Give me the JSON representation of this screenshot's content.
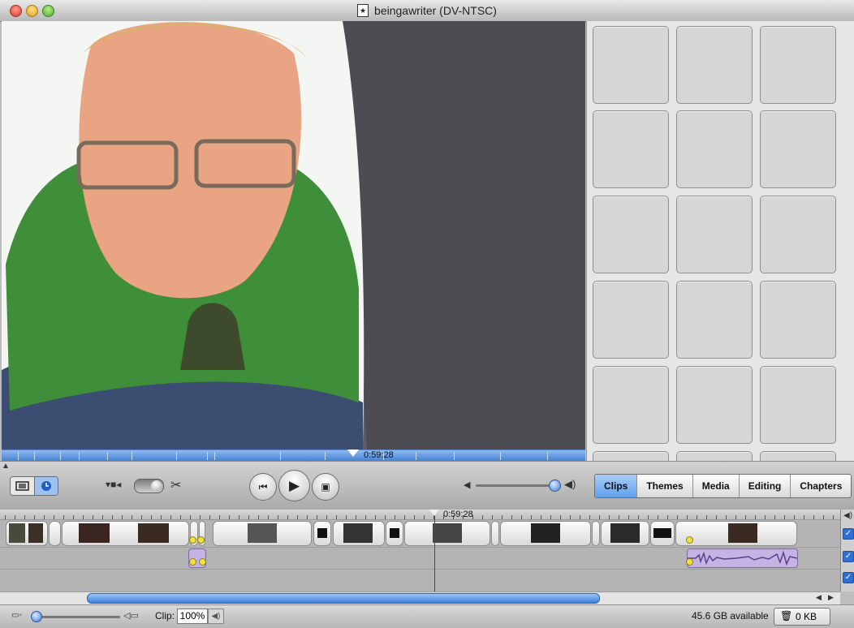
{
  "window": {
    "title": "beingawriter (DV-NTSC)"
  },
  "viewer": {
    "scrub_time": "0:59:28"
  },
  "timeline": {
    "playhead_time": "0:59:28"
  },
  "tabs": [
    {
      "label": "Clips",
      "active": true
    },
    {
      "label": "Themes",
      "active": false
    },
    {
      "label": "Media",
      "active": false
    },
    {
      "label": "Editing",
      "active": false
    },
    {
      "label": "Chapters",
      "active": false
    }
  ],
  "status": {
    "clip_label": "Clip:",
    "clip_volume": "100%",
    "disk_available": "45.6 GB available",
    "trash_size": "0 KB"
  },
  "colors": {
    "accent": "#5fa0ee",
    "audio_clip": "#c7b3e3",
    "scrubber": "#3f7fd6"
  },
  "icons": [
    "film-icon",
    "clock-icon",
    "camera-icon",
    "scissors-icon",
    "rewind-icon",
    "play-icon",
    "fullscreen-play-icon",
    "volume-low-icon",
    "volume-high-icon",
    "speaker-icon",
    "trash-icon"
  ]
}
